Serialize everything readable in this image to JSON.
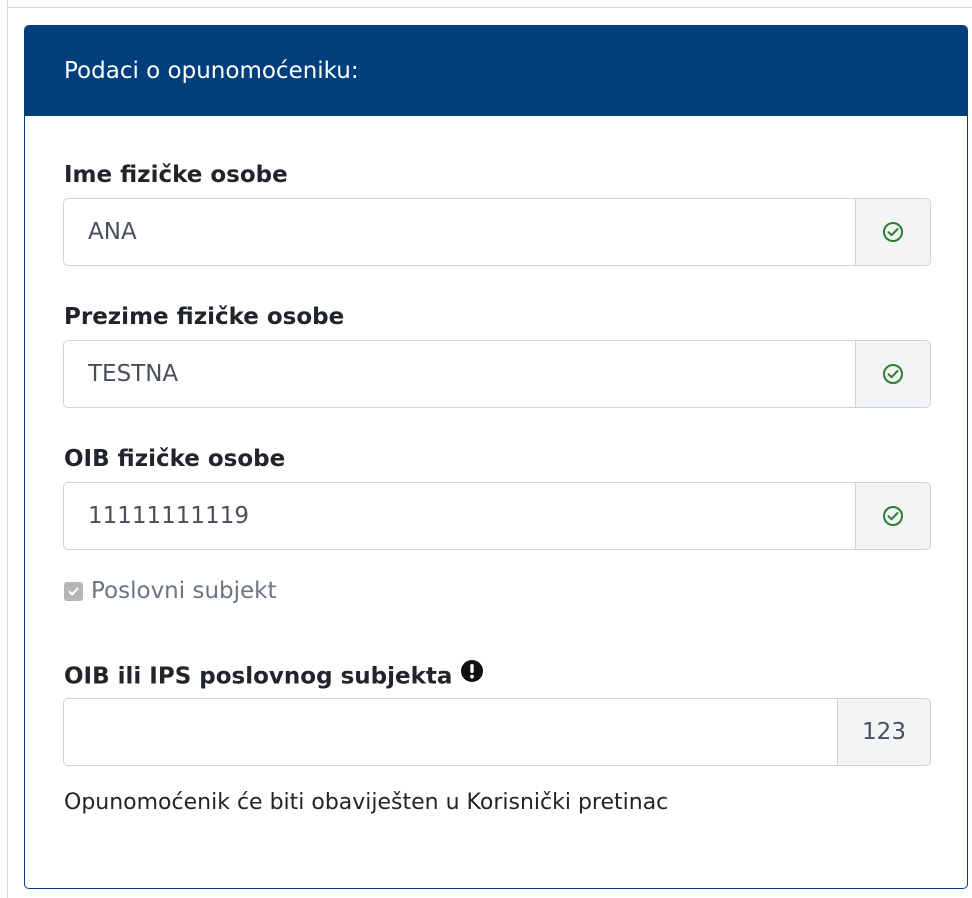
{
  "card": {
    "title": "Podaci o opunomoćeniku:"
  },
  "fields": {
    "first_name": {
      "label": "Ime fizičke osobe",
      "value": "ANA",
      "status_icon": "check-circle-icon"
    },
    "last_name": {
      "label": "Prezime fizičke osobe",
      "value": "TESTNA",
      "status_icon": "check-circle-icon"
    },
    "oib": {
      "label": "OIB fizičke osobe",
      "value": "11111111119",
      "status_icon": "check-circle-icon"
    },
    "business_checkbox": {
      "label": "Poslovni subjekt",
      "checked": true,
      "disabled": true
    },
    "business_oib": {
      "label": "OIB ili IPS poslovnog subjekta",
      "value": "",
      "addon_text": "123",
      "label_icon": "exclamation-circle-icon"
    }
  },
  "help_text": "Opunomoćenik će biti obaviješten u Korisnički pretinac",
  "colors": {
    "header_bg": "#003e7c",
    "success": "#2e7d32",
    "addon_bg": "#f3f4f5",
    "border": "#ced4da"
  }
}
